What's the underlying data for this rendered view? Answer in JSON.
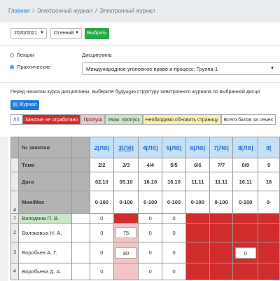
{
  "breadcrumb": {
    "home": "Главная",
    "item1": "Электронный журнал",
    "item2": "Электронный журнал"
  },
  "filters": {
    "year": "2020/2021",
    "semester": "Осенний",
    "choose_label": "Выбрать"
  },
  "lesson_type": {
    "lectures_label": "Лекции",
    "practical_label": "Практические",
    "selected": "Практические"
  },
  "discipline": {
    "label": "Дисциплина",
    "value": "Международное уголовное право и процесс: Группа-1"
  },
  "info_text": "Перед началом курса дисциплины, выберите будущую структуру электронного журнала по выбранной дисци",
  "journal_button": "Журнал",
  "legend": [
    {
      "text": "Лб",
      "bg": "#ffffff",
      "color": "#1f7ae0"
    },
    {
      "text": "Занятие не отработано",
      "bg": "#d12d2d",
      "color": "#ffffff"
    },
    {
      "text": "Пропуск",
      "bg": "#f2c4c4",
      "color": "#333333"
    },
    {
      "text": "Уваж. пропуск",
      "bg": "#c9e7c9",
      "color": "#333333"
    },
    {
      "text": "Необходимо обновить страницу",
      "bg": "#f7efb0",
      "color": "#333333"
    },
    {
      "text": "Всего балов за семес",
      "bg": "#ffffff",
      "color": "#333333"
    }
  ],
  "table": {
    "row_labels": {
      "lesson_no": "№ занятия",
      "topic": "Тема",
      "date": "Дата",
      "minmax": "Мин/Max",
      "hash": "#"
    },
    "columns": [
      {
        "no": "2[Лб]",
        "topic": "2/2",
        "date": "02.10",
        "minmax": "0-100"
      },
      {
        "no": "3[Лб]",
        "topic": "3/3",
        "date": "05.10",
        "minmax": "0-100"
      },
      {
        "no": "4[Лб]",
        "topic": "4/4",
        "date": "16.10",
        "minmax": "0-100"
      },
      {
        "no": "5[Лб]",
        "topic": "5/5",
        "date": "16.10",
        "minmax": "0-100"
      },
      {
        "no": "6[Лб]",
        "topic": "6/6",
        "date": "11.11",
        "minmax": "0-100"
      },
      {
        "no": "7[Лб]",
        "topic": "7/7",
        "date": "11.11",
        "minmax": "0-100"
      },
      {
        "no": "8[Лб]",
        "topic": "8/8",
        "date": "16.11",
        "minmax": "0-100"
      },
      {
        "no": "9[",
        "topic": "9",
        "date": "18",
        "minmax": "0-"
      }
    ],
    "students": [
      {
        "num": "1",
        "name": "Володина П. В.",
        "cells": [
          "0",
          "",
          "0",
          "0",
          "",
          "",
          "",
          ""
        ]
      },
      {
        "num": "2",
        "name": "Волоковых Н. А.",
        "cells": [
          "0",
          "75",
          "0",
          "0",
          "",
          "",
          "",
          ""
        ]
      },
      {
        "num": "3",
        "name": "Воробьев А. Г.",
        "cells": [
          "0",
          "80",
          "0",
          "0",
          "",
          "",
          "0",
          ""
        ]
      },
      {
        "num": "4",
        "name": "Воробьева Д. А.",
        "cells": [
          "0",
          "",
          "0",
          "0",
          "",
          "",
          "",
          ""
        ]
      }
    ]
  }
}
